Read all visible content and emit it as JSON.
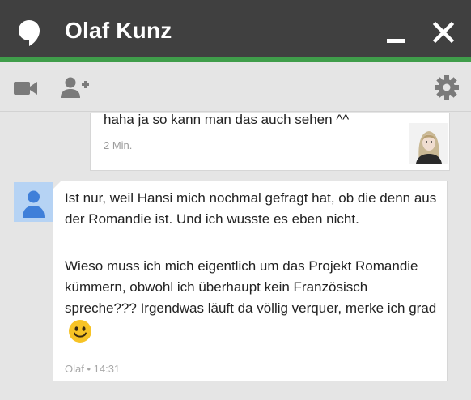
{
  "window": {
    "title": "Olaf Kunz",
    "accent_color": "#3f9d4a",
    "header_color": "#404040"
  },
  "titlebar": {
    "logo_icon": "hangouts-bubble-icon",
    "minimize_icon": "minimize-icon",
    "close_icon": "close-icon"
  },
  "toolbar": {
    "video_icon": "video-camera-icon",
    "add_person_icon": "add-person-icon",
    "settings_icon": "gear-icon"
  },
  "messages": [
    {
      "direction": "outgoing",
      "text": "haha ja so kann man das auch sehen ^^",
      "meta": "2 Min."
    },
    {
      "direction": "incoming",
      "paragraphs": [
        "Ist nur, weil Hansi mich nochmal gefragt hat, ob die denn aus der Romandie ist. Und ich wusste es eben nicht.",
        "Wieso muss ich mich eigentlich um das Projekt Romandie kümmern, obwohl ich überhaupt kein Französisch spreche??? Irgendwas läuft da völlig verquer, merke ich grad"
      ],
      "emoji": "smiley-emoji-icon",
      "meta": "Olaf • 14:31"
    }
  ]
}
